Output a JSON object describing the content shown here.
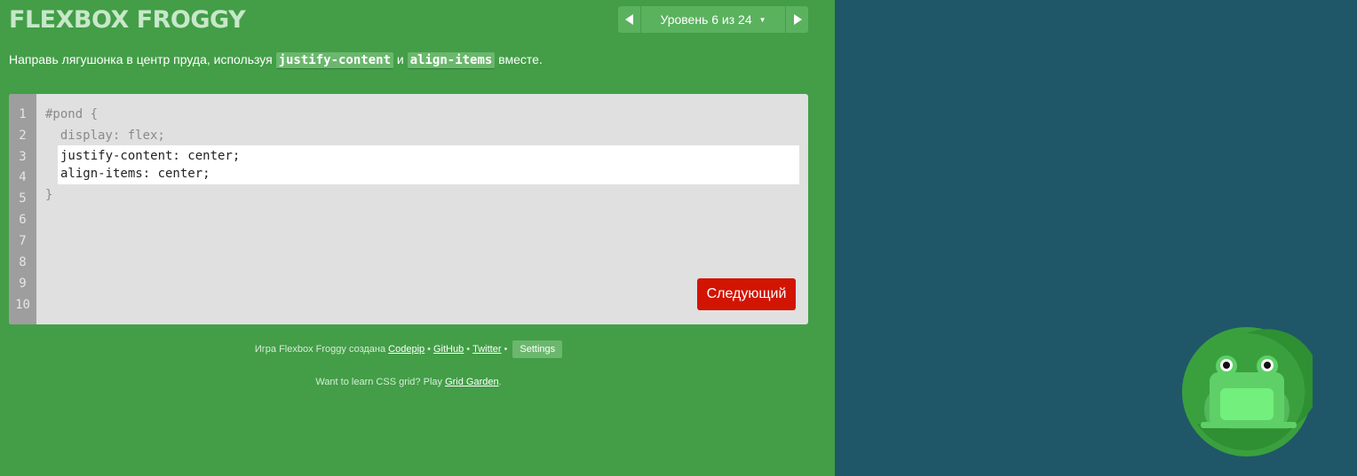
{
  "app": {
    "title": "FLEXBOX FROGGY"
  },
  "level_nav": {
    "prev_icon": "triangle-left-icon",
    "label": "Уровень 6 из 24",
    "dropdown_icon": "caret-down-icon",
    "next_icon": "triangle-right-icon"
  },
  "instructions": {
    "before": "Направь лягушонка в центр пруда, используя ",
    "code1": "justify-content",
    "middle": " и ",
    "code2": "align-items",
    "after": " вместе."
  },
  "editor": {
    "line_numbers": [
      "1",
      "2",
      "3",
      "4",
      "5",
      "6",
      "7",
      "8",
      "9",
      "10"
    ],
    "line1": "#pond {",
    "line2": "  display: flex;",
    "input_value": "justify-content: center;\nalign-items: center;",
    "line5": "}",
    "next_button": "Следующий"
  },
  "footer": {
    "credit_prefix": "Игра Flexbox Froggy создана ",
    "codepip": "Codepip",
    "bullet": "•",
    "github": "GitHub",
    "twitter": "Twitter",
    "settings": "Settings",
    "grid_prefix": "Want to learn CSS grid? Play ",
    "grid_link": "Grid Garden",
    "grid_suffix": "."
  },
  "colors": {
    "left_bg": "#439e47",
    "right_bg": "#1f5768",
    "next_button": "#d11502",
    "lilypad_outer": "#3aa03e",
    "frog": "#5fd068"
  },
  "pond": {
    "frog_icon": "green-frog-icon",
    "lilypad_icon": "lilypad-icon"
  }
}
